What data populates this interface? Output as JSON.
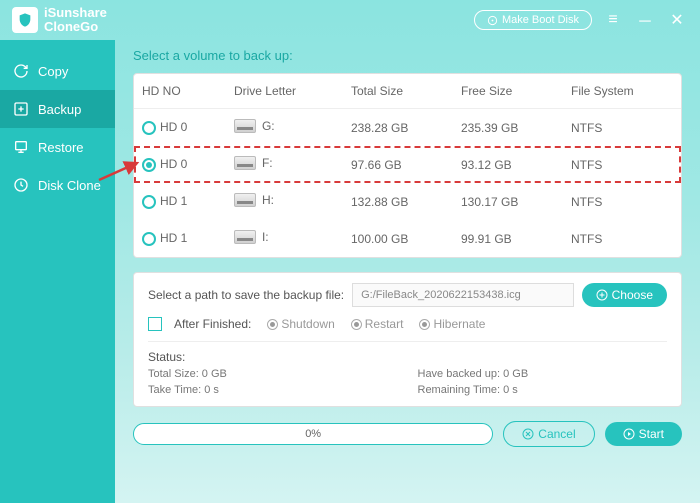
{
  "app": {
    "line1": "iSunshare",
    "line2": "CloneGo"
  },
  "titlebar": {
    "makeBoot": "Make Boot Disk"
  },
  "sidebar": {
    "items": [
      {
        "label": "Copy"
      },
      {
        "label": "Backup"
      },
      {
        "label": "Restore"
      },
      {
        "label": "Disk Clone"
      }
    ]
  },
  "section_title": "Select a volume to back up:",
  "table": {
    "headers": {
      "hd": "HD NO",
      "letter": "Drive Letter",
      "total": "Total Size",
      "free": "Free Size",
      "fs": "File System"
    },
    "rows": [
      {
        "hd": "HD 0",
        "letter": "G:",
        "total": "238.28 GB",
        "free": "235.39 GB",
        "fs": "NTFS"
      },
      {
        "hd": "HD 0",
        "letter": "F:",
        "total": "97.66 GB",
        "free": "93.12 GB",
        "fs": "NTFS"
      },
      {
        "hd": "HD 1",
        "letter": "H:",
        "total": "132.88 GB",
        "free": "130.17 GB",
        "fs": "NTFS"
      },
      {
        "hd": "HD 1",
        "letter": "I:",
        "total": "100.00 GB",
        "free": "99.91 GB",
        "fs": "NTFS"
      }
    ]
  },
  "path": {
    "label": "Select a path to save the backup file:",
    "value": "G:/FileBack_20206221534​38.icg",
    "choose": "Choose"
  },
  "after": {
    "label": "After Finished:",
    "options": [
      "Shutdown",
      "Restart",
      "Hibernate"
    ]
  },
  "status": {
    "title": "Status:",
    "totalSize": "Total Size: 0 GB",
    "backedUp": "Have backed up: 0 GB",
    "takeTime": "Take Time: 0 s",
    "remaining": "Remaining Time: 0 s"
  },
  "footer": {
    "progress": "0%",
    "cancel": "Cancel",
    "start": "Start"
  }
}
